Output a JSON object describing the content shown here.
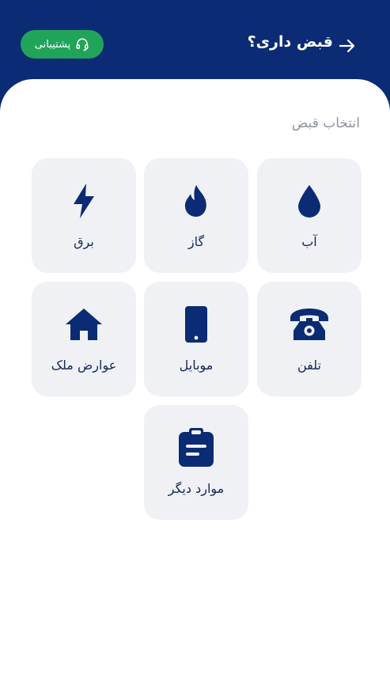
{
  "header": {
    "title": "قبض داری؟",
    "support_label": "پشتیبانی",
    "back_icon": "arrow-right-icon",
    "support_icon": "headset-icon"
  },
  "content": {
    "section_label": "انتخاب قبض",
    "tiles": [
      {
        "label": "آب",
        "icon": "water-drop-icon"
      },
      {
        "label": "گاز",
        "icon": "flame-icon"
      },
      {
        "label": "برق",
        "icon": "lightning-icon"
      },
      {
        "label": "تلفن",
        "icon": "telephone-icon"
      },
      {
        "label": "موبایل",
        "icon": "mobile-phone-icon"
      },
      {
        "label": "عوارض ملک",
        "icon": "house-icon"
      },
      {
        "label": "موارد دیگر",
        "icon": "clipboard-icon"
      }
    ]
  },
  "colors": {
    "header_bg": "#0b2b74",
    "support_bg": "#20a45a",
    "tile_bg": "#eff1f4",
    "icon": "#0b2b74",
    "label_text": "#14285a",
    "section_label": "#8c92a0"
  }
}
